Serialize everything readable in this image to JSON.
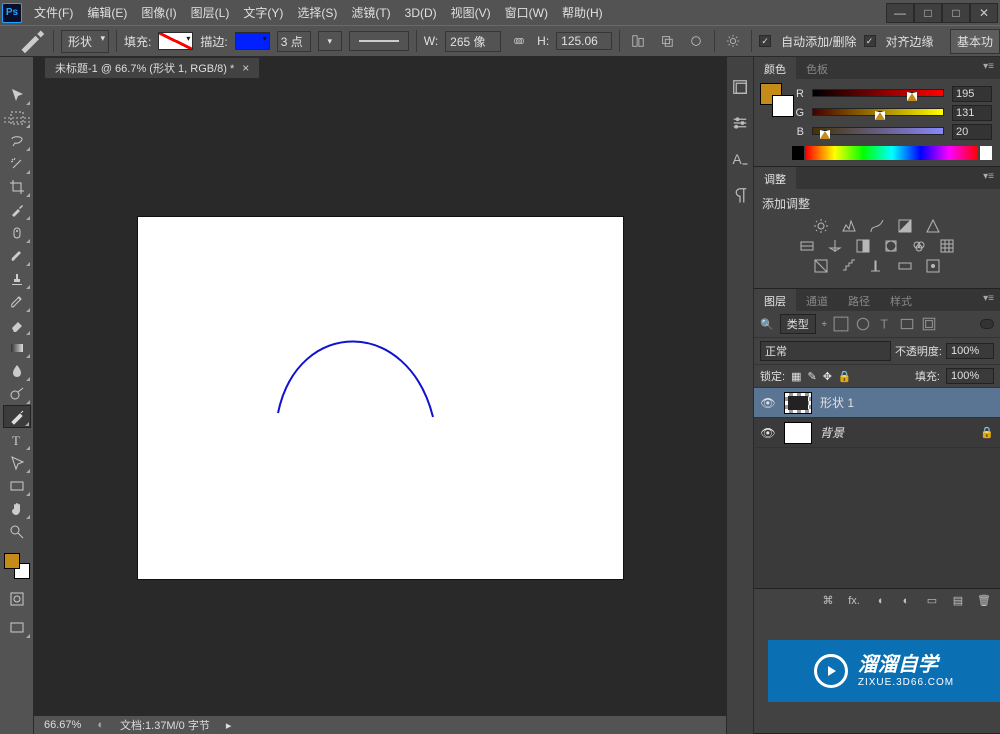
{
  "app": {
    "logo": "Ps"
  },
  "menu": [
    "文件(F)",
    "编辑(E)",
    "图像(I)",
    "图层(L)",
    "文字(Y)",
    "选择(S)",
    "滤镜(T)",
    "3D(D)",
    "视图(V)",
    "窗口(W)",
    "帮助(H)"
  ],
  "window_controls": {
    "min": "—",
    "full": "□",
    "max": "□",
    "close": "✕"
  },
  "options": {
    "mode_label": "形状",
    "fill_label": "填充:",
    "stroke_label": "描边:",
    "stroke_width": "3 点",
    "w_label": "W:",
    "w_value": "265 像",
    "h_label": "H:",
    "h_value": "125.06",
    "auto_label": "自动添加/删除",
    "align_label": "对齐边缘",
    "basic_btn": "基本功"
  },
  "document": {
    "tab": "未标题-1 @ 66.7% (形状 1, RGB/8) *",
    "zoom": "66.67%",
    "docinfo": "文档:1.37M/0 字节"
  },
  "color_panel": {
    "tab_color": "颜色",
    "tab_swatch": "色板",
    "r_label": "R",
    "r_value": "195",
    "g_label": "G",
    "g_value": "131",
    "b_label": "B",
    "b_value": "20"
  },
  "adjust_panel": {
    "tab": "调整",
    "title": "添加调整"
  },
  "layers_panel": {
    "tabs": {
      "layer": "图层",
      "channel": "通道",
      "path": "路径",
      "style": "样式"
    },
    "kind_label": "类型",
    "blend_label": "正常",
    "opacity_label": "不透明度:",
    "opacity_value": "100%",
    "lock_label": "锁定:",
    "fill_label": "填充:",
    "fill_value": "100%",
    "layer1": "形状 1",
    "layer_bg": "背景"
  },
  "filter_row": {
    "search_icon": "🔍"
  },
  "watermark": {
    "title": "溜溜自学",
    "url": "ZIXUE.3D66.COM"
  }
}
